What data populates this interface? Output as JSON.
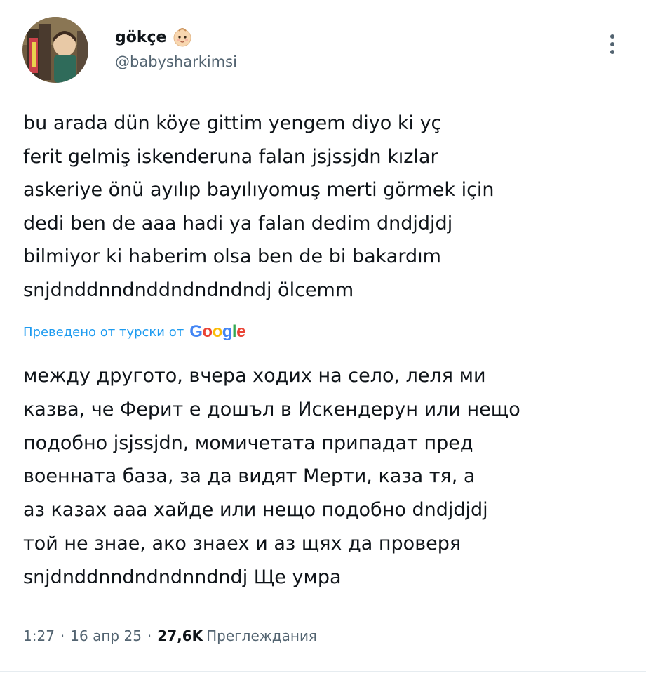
{
  "author": {
    "display_name": "gökçe",
    "handle": "@babysharkimsi",
    "emoji_icon": "baby-face-icon",
    "more_icon": "more-vertical-icon"
  },
  "tweet": {
    "text": "bu arada dün köye gittim yengem diyo ki yç\nferit gelmiş iskenderuna falan jsjssjdn kızlar\naskeriye önü ayılıp bayılıyomuş merti görmek için\ndedi ben de aaa hadi ya falan dedim dndjdjdj\nbilmiyor ki haberim olsa ben de bi bakardım\nsnjdnddnndnddndndndndj ölcemm"
  },
  "translation": {
    "label": "Преведено от турски от",
    "provider": "Google",
    "text": "между другото, вчера ходих на село, леля ми\nказва, че Ферит е дошъл в Искендерун или нещо\nподобно jsjssjdn, момичетата припадат пред\nвоенната база, за да видят Мерти, каза тя, а\nаз казах ааа хайде или нещо подобно dndjdjdj\nтой не знае, ако знаех и аз щях да проверя\nsnjdnddnndndndnndndj Ще умра"
  },
  "meta": {
    "time": "1:27",
    "date": "16 апр 25",
    "separator": "·",
    "views_count": "27,6K",
    "views_label": "Преглеждания"
  },
  "colors": {
    "text": "#0f1419",
    "secondary": "#536471",
    "link": "#1d9bf0",
    "google_blue": "#4285F4",
    "google_red": "#EA4335",
    "google_yellow": "#FBBC05",
    "google_green": "#34A853"
  }
}
